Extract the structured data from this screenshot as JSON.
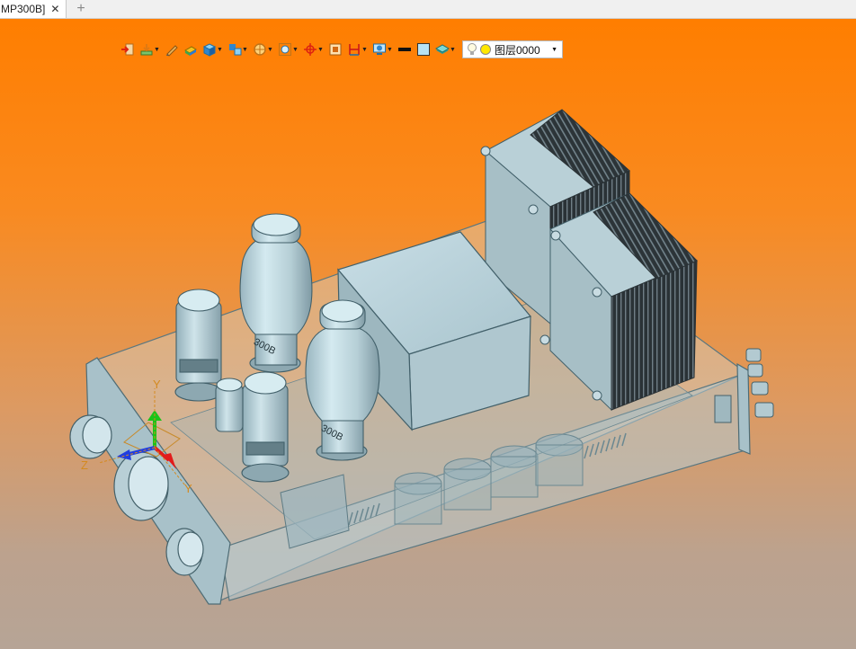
{
  "tab": {
    "title": "MP300B]",
    "close_glyph": "✕",
    "new_tab_glyph": "+"
  },
  "toolbar": {
    "buttons": [
      {
        "icon": "import-icon",
        "dropdown": false
      },
      {
        "icon": "snap-icon",
        "dropdown": true
      },
      {
        "icon": "pen-icon",
        "dropdown": false
      },
      {
        "icon": "render-mode-icon",
        "dropdown": false
      },
      {
        "icon": "cube-view-icon",
        "dropdown": true
      },
      {
        "icon": "view-orient-icon",
        "dropdown": true
      },
      {
        "icon": "section-icon",
        "dropdown": true
      },
      {
        "icon": "zoom-fit-icon",
        "dropdown": true
      },
      {
        "icon": "origin-icon",
        "dropdown": true
      },
      {
        "icon": "frame-icon",
        "dropdown": false
      },
      {
        "icon": "dimension-icon",
        "dropdown": true
      },
      {
        "icon": "display-icon",
        "dropdown": true
      },
      {
        "icon": "line-style-icon",
        "dropdown": false
      },
      {
        "icon": "color-swatch-icon",
        "dropdown": false
      },
      {
        "icon": "layer-stack-icon",
        "dropdown": true
      }
    ],
    "layer_selector": {
      "value": "图层0000"
    },
    "colors": {
      "line": "#111111",
      "swatch": "#b7e3f5"
    }
  },
  "triad": {
    "x": "X",
    "y": "Y",
    "z": "Z",
    "y2": "Y"
  },
  "model": {
    "tube_text_1": "300B",
    "tube_text_2": "300B"
  }
}
